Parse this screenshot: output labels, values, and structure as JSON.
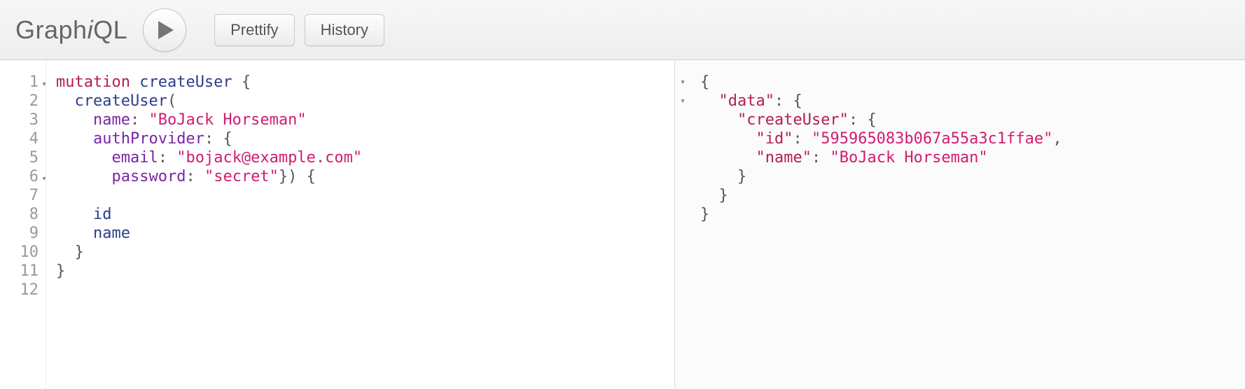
{
  "app": {
    "name_html": "Graph<em>i</em>QL"
  },
  "toolbar": {
    "prettify_label": "Prettify",
    "history_label": "History"
  },
  "editor": {
    "line_numbers": [
      "1",
      "2",
      "3",
      "4",
      "5",
      "6",
      "7",
      "8",
      "9",
      "10",
      "11",
      "12"
    ],
    "fold_lines": [
      1,
      6
    ],
    "code": {
      "mutation_kw": "mutation",
      "op_name": "createUser",
      "field": "createUser",
      "arg_name": "name",
      "arg_name_val": "\"BoJack Horseman\"",
      "arg_auth": "authProvider",
      "arg_email": "email",
      "arg_email_val": "\"bojack@example.com\"",
      "arg_password": "password",
      "arg_password_val": "\"secret\"",
      "sel_id": "id",
      "sel_name": "name"
    }
  },
  "result": {
    "fold_lines": [
      1,
      2
    ],
    "json": {
      "data_key": "\"data\"",
      "createUser_key": "\"createUser\"",
      "id_key": "\"id\"",
      "id_val": "\"595965083b067a55a3c1ffae\"",
      "name_key": "\"name\"",
      "name_val": "\"BoJack Horseman\""
    }
  }
}
